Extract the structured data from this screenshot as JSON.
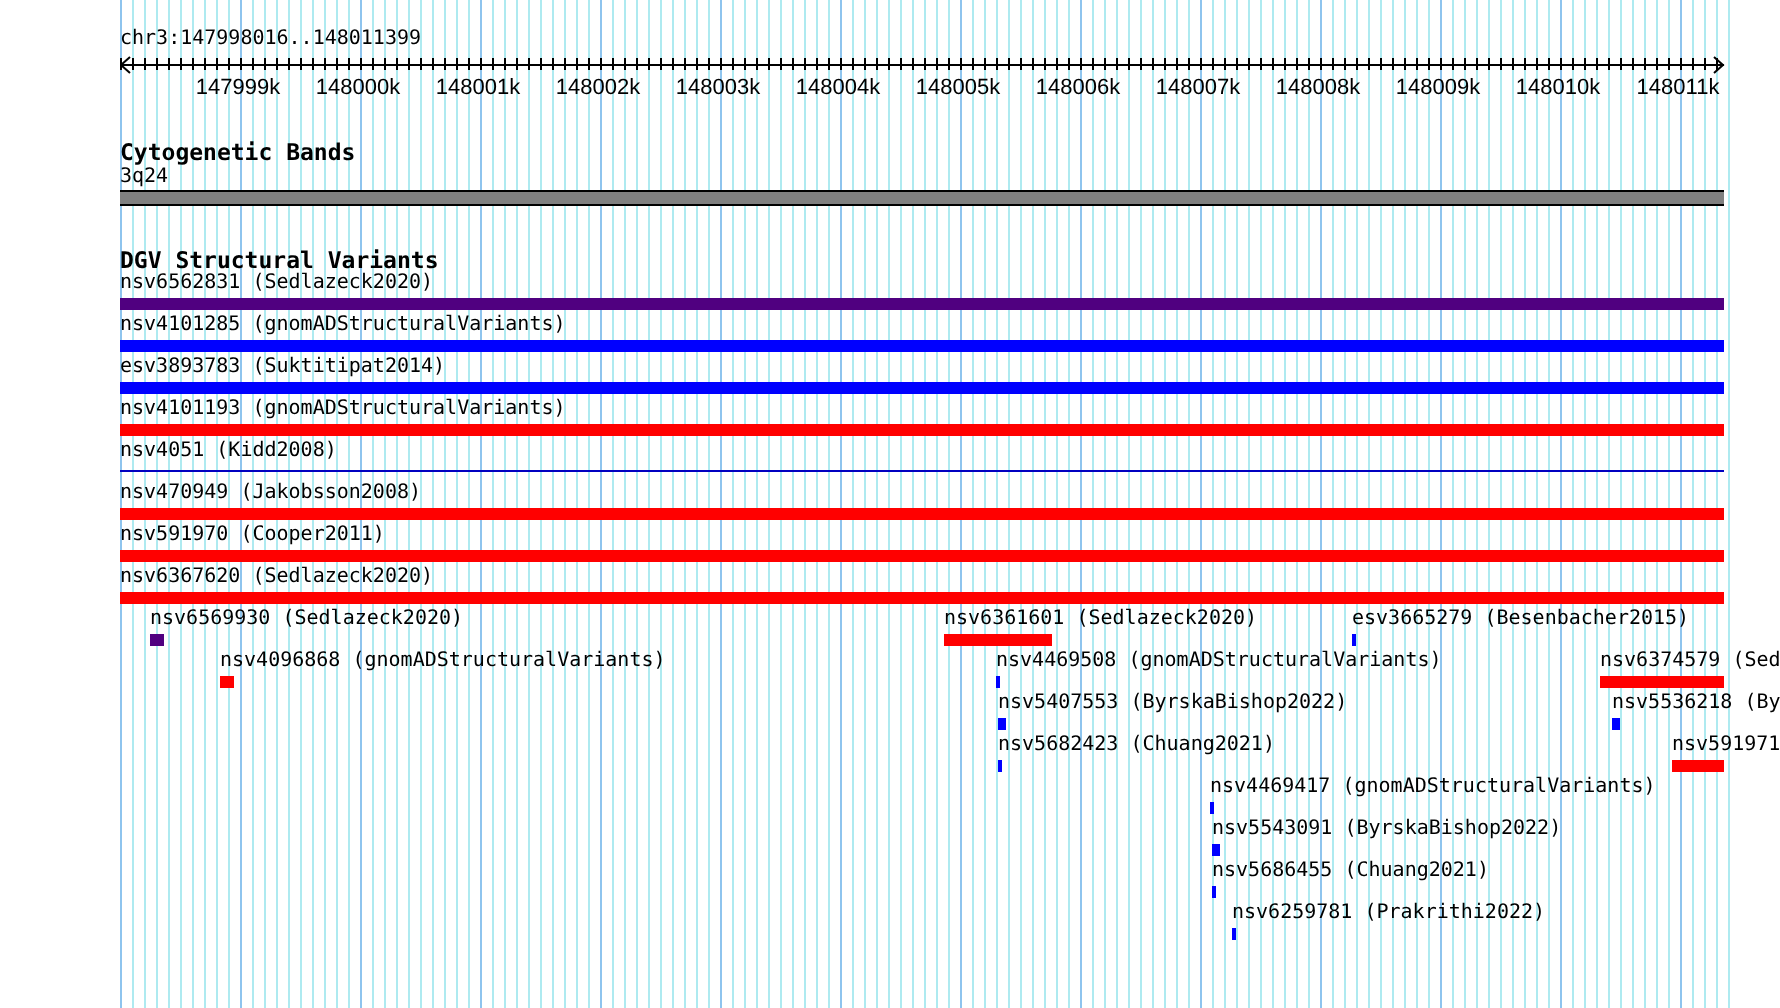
{
  "location": "chr3:147998016..148011399",
  "ruler": {
    "ticks": [
      "147999k",
      "148000k",
      "148001k",
      "148002k",
      "148003k",
      "148004k",
      "148005k",
      "148006k",
      "148007k",
      "148008k",
      "148009k",
      "148010k",
      "148011k"
    ]
  },
  "cytogenetic_bands": {
    "title": "Cytogenetic Bands",
    "band_label": "3q24"
  },
  "dgv_track": {
    "title": "DGV Structural Variants",
    "features": [
      {
        "label": "nsv6562831 (Sedlazeck2020)",
        "color": "#500080",
        "kind": "bar"
      },
      {
        "label": "nsv4101285 (gnomADStructuralVariants)",
        "color": "#0000ff",
        "kind": "bar"
      },
      {
        "label": "esv3893783 (Suktitipat2014)",
        "color": "#0000ff",
        "kind": "bar"
      },
      {
        "label": "nsv4101193 (gnomADStructuralVariants)",
        "color": "#ff0000",
        "kind": "bar"
      },
      {
        "label": "nsv4051 (Kidd2008)",
        "color": "#0000c0",
        "kind": "line"
      },
      {
        "label": "nsv470949 (Jakobsson2008)",
        "color": "#ff0000",
        "kind": "bar"
      },
      {
        "label": "nsv591970 (Cooper2011)",
        "color": "#ff0000",
        "kind": "bar"
      },
      {
        "label": "nsv6367620 (Sedlazeck2020)",
        "color": "#ff0000",
        "kind": "bar"
      }
    ],
    "packed_rows": [
      [
        {
          "label": "nsv6569930 (Sedlazeck2020)",
          "color": "#500080"
        },
        {
          "label": "nsv6361601 (Sedlazeck2020)",
          "color": "#ff0000"
        },
        {
          "label": "esv3665279 (Besenbacher2015)",
          "color": "#0000ff"
        }
      ],
      [
        {
          "label": "nsv4096868 (gnomADStructuralVariants)",
          "color": "#ff0000"
        },
        {
          "label": "nsv4469508 (gnomADStructuralVariants)",
          "color": "#0000ff"
        },
        {
          "label": "nsv6374579 (Sed",
          "color": "#ff0000"
        }
      ],
      [
        {
          "label": "nsv5407553 (ByrskaBishop2022)",
          "color": "#0000ff"
        },
        {
          "label": "nsv5536218 (By",
          "color": "#0000ff"
        }
      ],
      [
        {
          "label": "nsv5682423 (Chuang2021)",
          "color": "#0000ff"
        },
        {
          "label": "nsv591971",
          "color": "#ff0000"
        }
      ],
      [
        {
          "label": "nsv4469417 (gnomADStructuralVariants)",
          "color": "#0000ff"
        }
      ],
      [
        {
          "label": "nsv5543091 (ByrskaBishop2022)",
          "color": "#0000ff"
        }
      ],
      [
        {
          "label": "nsv5686455 (Chuang2021)",
          "color": "#0000ff"
        }
      ],
      [
        {
          "label": "nsv6259781 (Prakrithi2022)",
          "color": "#0000ff"
        }
      ]
    ]
  }
}
